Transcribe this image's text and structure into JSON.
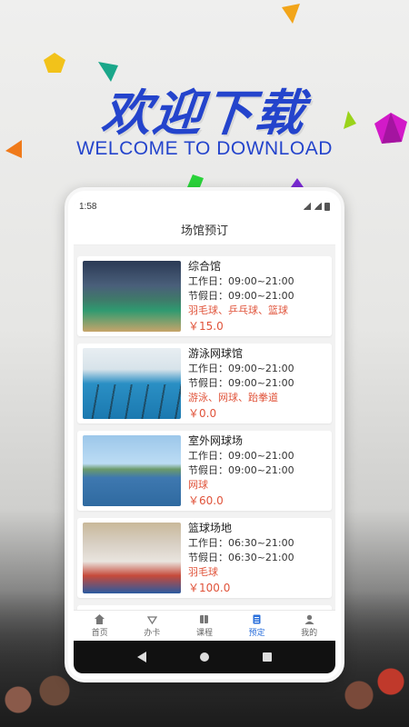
{
  "hero": {
    "title": "欢迎下载",
    "subtitle": "WELCOME TO DOWNLOAD",
    "accent_color": "#2444cc"
  },
  "status_bar": {
    "time": "1:58"
  },
  "app": {
    "page_title": "场馆预订",
    "venues": [
      {
        "name": "综合馆",
        "weekday_hours": "工作日：09:00~21:00",
        "holiday_hours": "节假日：09:00~21:00",
        "sports": "羽毛球、乒乓球、篮球",
        "price": "￥15.0"
      },
      {
        "name": "游泳网球馆",
        "weekday_hours": "工作日：09:00~21:00",
        "holiday_hours": "节假日：09:00~21:00",
        "sports": "游泳、网球、跆拳道",
        "price": "￥0.0"
      },
      {
        "name": "室外网球场",
        "weekday_hours": "工作日：09:00~21:00",
        "holiday_hours": "节假日：09:00~21:00",
        "sports": "网球",
        "price": "￥60.0"
      },
      {
        "name": "篮球场地",
        "weekday_hours": "工作日：06:30~21:00",
        "holiday_hours": "节假日：06:30~21:00",
        "sports": "羽毛球",
        "price": "￥100.0"
      }
    ],
    "tabs": [
      {
        "label": "首页",
        "icon": "home-icon"
      },
      {
        "label": "办卡",
        "icon": "card-icon"
      },
      {
        "label": "课程",
        "icon": "book-icon"
      },
      {
        "label": "预定",
        "icon": "booking-icon",
        "active": true
      },
      {
        "label": "我的",
        "icon": "user-icon"
      }
    ],
    "price_color": "#e0533a",
    "active_tab_color": "#2a6fdb"
  }
}
